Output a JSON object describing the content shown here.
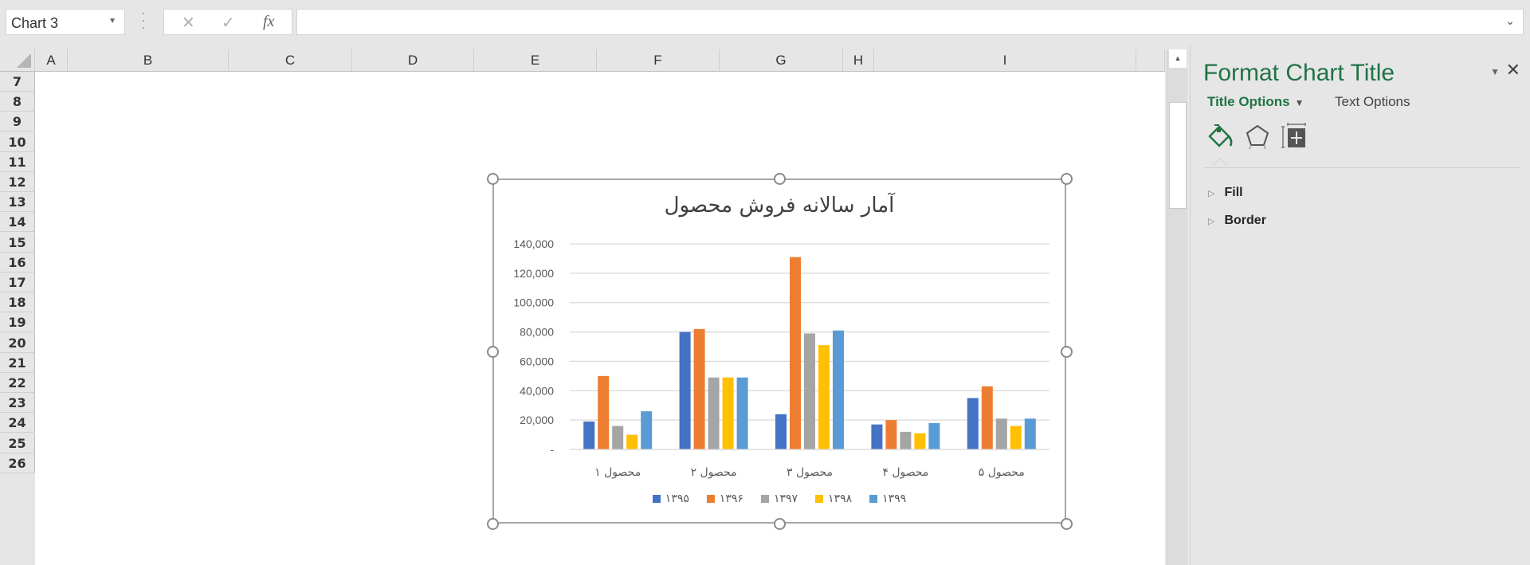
{
  "formula_bar": {
    "name_box": "Chart 3",
    "cancel_icon": "✕",
    "enter_icon": "✓",
    "fx_label": "fx",
    "formula_value": ""
  },
  "grid": {
    "columns": [
      "A",
      "B",
      "C",
      "D",
      "E",
      "F",
      "G",
      "H",
      "I"
    ],
    "rows": [
      "7",
      "8",
      "9",
      "10",
      "11",
      "12",
      "13",
      "14",
      "15",
      "16",
      "17",
      "18",
      "19",
      "20",
      "21",
      "22",
      "23",
      "24",
      "25",
      "26"
    ]
  },
  "task_pane": {
    "title": "Format Chart Title",
    "tabs": [
      {
        "label": "Title Options",
        "active": true
      },
      {
        "label": "Text Options",
        "active": false
      }
    ],
    "icons": [
      "fill-line-icon",
      "effects-icon",
      "size-properties-icon"
    ],
    "sections": [
      {
        "label": "Fill",
        "expanded": false
      },
      {
        "label": "Border",
        "expanded": false
      }
    ],
    "accent_color": "#217346"
  },
  "chart_data": {
    "type": "bar",
    "title": "آمار سالانه فروش محصول",
    "categories": [
      "محصول ۱",
      "محصول ۲",
      "محصول ۳",
      "محصول ۴",
      "محصول ۵"
    ],
    "series": [
      {
        "name": "۱۳۹۵",
        "color": "#4472C4",
        "values": [
          19000,
          80000,
          24000,
          17000,
          35000
        ]
      },
      {
        "name": "۱۳۹۶",
        "color": "#ED7D31",
        "values": [
          50000,
          82000,
          131000,
          20000,
          43000
        ]
      },
      {
        "name": "۱۳۹۷",
        "color": "#A5A5A5",
        "values": [
          16000,
          49000,
          79000,
          12000,
          21000
        ]
      },
      {
        "name": "۱۳۹۸",
        "color": "#FFC000",
        "values": [
          10000,
          49000,
          71000,
          11000,
          16000
        ]
      },
      {
        "name": "۱۳۹۹",
        "color": "#5B9BD5",
        "values": [
          26000,
          49000,
          81000,
          18000,
          21000
        ]
      }
    ],
    "y_ticks": [
      "-",
      "20,000",
      "40,000",
      "60,000",
      "80,000",
      "100,000",
      "120,000",
      "140,000"
    ],
    "ylim": [
      0,
      140000
    ],
    "xlabel": "",
    "ylabel": "",
    "grid": true,
    "legend_position": "bottom"
  }
}
